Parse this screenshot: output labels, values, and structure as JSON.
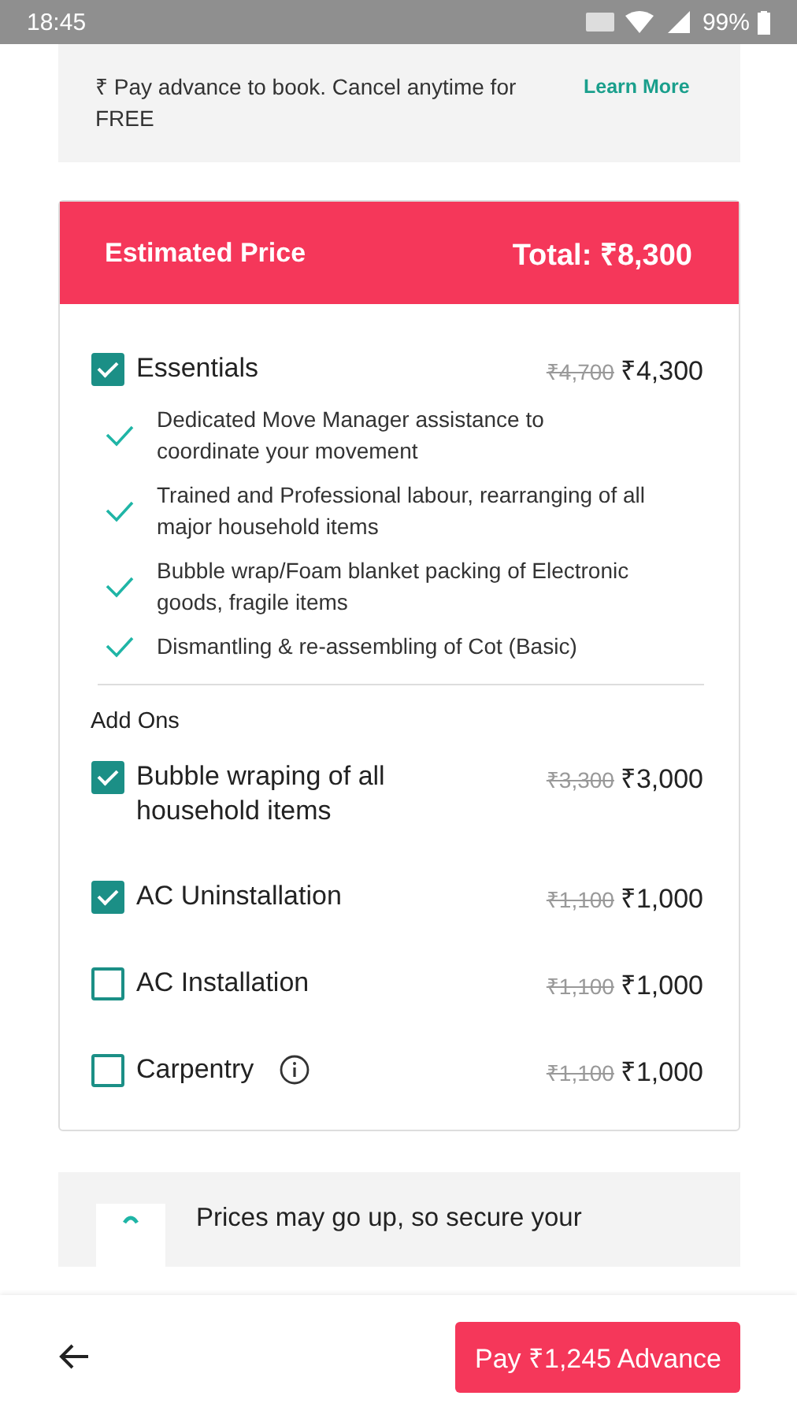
{
  "status_bar": {
    "time": "18:45",
    "battery": "99%"
  },
  "notice": {
    "text": "₹ Pay advance to book. Cancel anytime for FREE",
    "link": "Learn More"
  },
  "price_card": {
    "title": "Estimated Price",
    "total": "Total: ₹8,300",
    "package": {
      "label": "Essentials",
      "checked": true,
      "old_price": "₹4,700",
      "price": "₹4,300"
    },
    "features": [
      "Dedicated Move Manager assistance to coordinate your movement",
      "Trained and Professional labour, rearranging of all major household items",
      "Bubble wrap/Foam blanket packing of Electronic goods, fragile items",
      "Dismantling & re-assembling of Cot (Basic)"
    ],
    "addons_title": "Add Ons",
    "addons": [
      {
        "label": "Bubble wraping of all household items",
        "checked": true,
        "info": false,
        "old_price": "₹3,300",
        "price": "₹3,000"
      },
      {
        "label": "AC Uninstallation",
        "checked": true,
        "info": false,
        "old_price": "₹1,100",
        "price": "₹1,000"
      },
      {
        "label": "AC Installation",
        "checked": false,
        "info": false,
        "old_price": "₹1,100",
        "price": "₹1,000"
      },
      {
        "label": "Carpentry",
        "checked": false,
        "info": true,
        "old_price": "₹1,100",
        "price": "₹1,000"
      }
    ]
  },
  "promo": {
    "text": "Prices may go up, so secure your"
  },
  "bottom_bar": {
    "pay_button": "Pay ₹1,245 Advance"
  }
}
